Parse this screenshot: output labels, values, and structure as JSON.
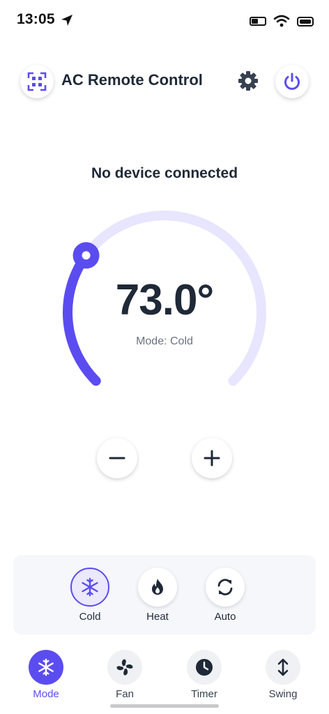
{
  "status_bar": {
    "time": "13:05",
    "icons": [
      "location-arrow-icon",
      "battery-saver-icon",
      "wifi-icon",
      "battery-icon"
    ]
  },
  "header": {
    "title": "AC Remote Control",
    "left_icon": "qr-scan-icon",
    "right_icons": [
      "gear-icon",
      "power-icon"
    ]
  },
  "device": {
    "status": "No device connected"
  },
  "thermostat": {
    "temperature": "73.0°",
    "mode_text": "Mode: Cold",
    "level_fraction": 0.3,
    "accent_color": "#5b4cf0",
    "track_color": "#e7e5ff"
  },
  "controls": {
    "decrease_icon": "minus-icon",
    "increase_icon": "plus-icon"
  },
  "mode_options": [
    {
      "label": "Cold",
      "icon": "snowflake-icon",
      "active": true
    },
    {
      "label": "Heat",
      "icon": "flame-icon",
      "active": false
    },
    {
      "label": "Auto",
      "icon": "refresh-icon",
      "active": false
    }
  ],
  "bottom_nav": [
    {
      "label": "Mode",
      "icon": "snowflake-icon",
      "active": true
    },
    {
      "label": "Fan",
      "icon": "fan-icon",
      "active": false
    },
    {
      "label": "Timer",
      "icon": "clock-icon",
      "active": false
    },
    {
      "label": "Swing",
      "icon": "swing-arrows-icon",
      "active": false
    }
  ]
}
